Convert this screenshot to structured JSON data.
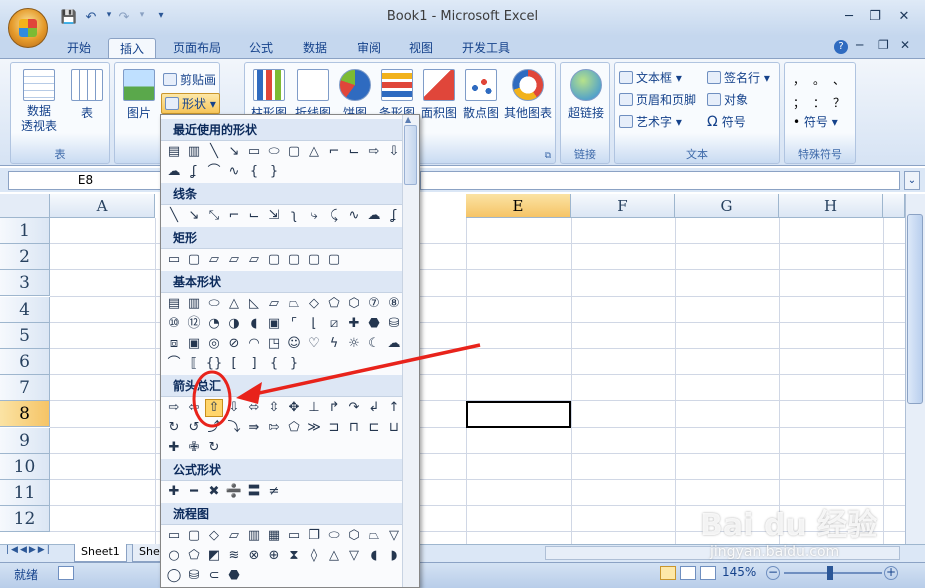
{
  "window": {
    "title": "Book1 - Microsoft Excel"
  },
  "tabs": [
    {
      "label": "开始"
    },
    {
      "label": "插入"
    },
    {
      "label": "页面布局"
    },
    {
      "label": "公式"
    },
    {
      "label": "数据"
    },
    {
      "label": "审阅"
    },
    {
      "label": "视图"
    },
    {
      "label": "开发工具"
    }
  ],
  "ribbon": {
    "table_group": {
      "label": "表",
      "pivot": "数据\n透视表",
      "table": "表"
    },
    "illustrations": {
      "picture": "图片",
      "clipart": "剪贴画",
      "shapes": "形状"
    },
    "charts": {
      "column": "柱形图",
      "line": "折线图",
      "pie": "饼图",
      "bar": "条形图",
      "area": "面积图",
      "scatter": "散点图",
      "other": "其他图表"
    },
    "links": {
      "label": "链接",
      "hyperlink": "超链接"
    },
    "text": {
      "label": "文本",
      "textbox": "文本框",
      "header_footer": "页眉和页脚",
      "wordart": "艺术字",
      "signature": "签名行",
      "object": "对象",
      "symbol": "符号"
    },
    "special": {
      "label": "特殊符号",
      "symbol": "符号",
      "chars": [
        "，",
        "。",
        "、",
        "；",
        "：",
        "？"
      ]
    }
  },
  "formula_bar": {
    "name_box": "E8",
    "formula": ""
  },
  "columns": [
    "A",
    "E",
    "F",
    "G",
    "H"
  ],
  "rows": [
    "1",
    "2",
    "3",
    "4",
    "5",
    "6",
    "7",
    "8",
    "9",
    "10",
    "11",
    "12"
  ],
  "selected_cell": "E8",
  "sheets": {
    "active": "Sheet1",
    "partial": "She"
  },
  "status": {
    "ready": "就绪",
    "zoom": "145%"
  },
  "dropdown": {
    "sections": [
      {
        "title": "最近使用的形状"
      },
      {
        "title": "线条"
      },
      {
        "title": "矩形"
      },
      {
        "title": "基本形状"
      },
      {
        "title": "箭头总汇"
      },
      {
        "title": "公式形状"
      },
      {
        "title": "流程图"
      }
    ],
    "highlighted_shape": "up-arrow"
  },
  "watermark": {
    "brand": "Bai du 经验",
    "url": "jingyan.baidu.com"
  },
  "colors": {
    "accent": "#15428b",
    "highlight": "#ffd56b",
    "annotation": "#e8231b"
  }
}
